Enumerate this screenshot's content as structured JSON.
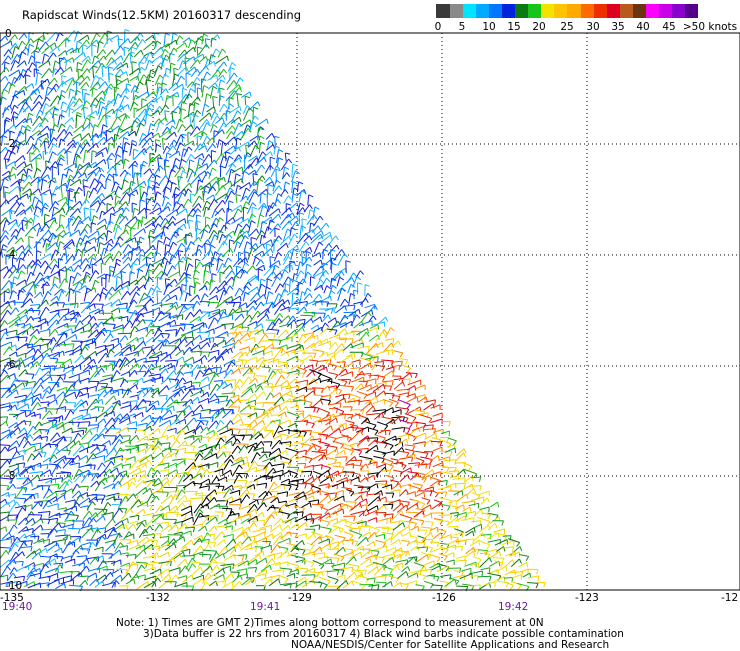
{
  "title": "Rapidscat Winds(12.5KM) 20160317 descending",
  "legend": {
    "unit": "knots",
    "swatches": [
      {
        "from": 0,
        "color": "#3a3a3a"
      },
      {
        "from": 2.5,
        "color": "#8a8a8a"
      },
      {
        "from": 5,
        "color": "#00e4ff"
      },
      {
        "from": 7.5,
        "color": "#00aaff"
      },
      {
        "from": 10,
        "color": "#0077ff"
      },
      {
        "from": 12.5,
        "color": "#0022dd"
      },
      {
        "from": 15,
        "color": "#0b7a10"
      },
      {
        "from": 17.5,
        "color": "#16c51a"
      },
      {
        "from": 20,
        "color": "#f2e300"
      },
      {
        "from": 22.5,
        "color": "#ffc400"
      },
      {
        "from": 25,
        "color": "#ffaa00"
      },
      {
        "from": 27.5,
        "color": "#ff6a00"
      },
      {
        "from": 30,
        "color": "#ee2d00"
      },
      {
        "from": 32.5,
        "color": "#dd0022"
      },
      {
        "from": 35,
        "color": "#b85a1d"
      },
      {
        "from": 37.5,
        "color": "#6b3310"
      },
      {
        "from": 40,
        "color": "#ff00ff"
      },
      {
        "from": 42.5,
        "color": "#c800ea"
      },
      {
        "from": 45,
        "color": "#8a00cc"
      },
      {
        "from": 47.5,
        "color": "#55008a"
      }
    ],
    "labels": [
      "0",
      "5",
      "10",
      "15",
      "20",
      "25",
      "30",
      "35",
      "40",
      "45",
      ">50 knots"
    ]
  },
  "axes": {
    "lon_ticks": [
      "-135",
      "-132",
      "-129",
      "-126",
      "-123",
      "-12"
    ],
    "lat_ticks": [
      "0",
      "-2",
      "-4",
      "-6",
      "-8",
      "-10"
    ],
    "times": [
      "19:40",
      "19:41",
      "19:42"
    ]
  },
  "notes": {
    "line1": "Note: 1) Times are GMT 2)Times along bottom correspond to measurement at 0N",
    "line2": "3)Data buffer is 22 hrs from 20160317 4) Black wind barbs indicate possible contamination",
    "line3": "NOAA/NESDIS/Center for Satellite Applications and Research"
  }
}
